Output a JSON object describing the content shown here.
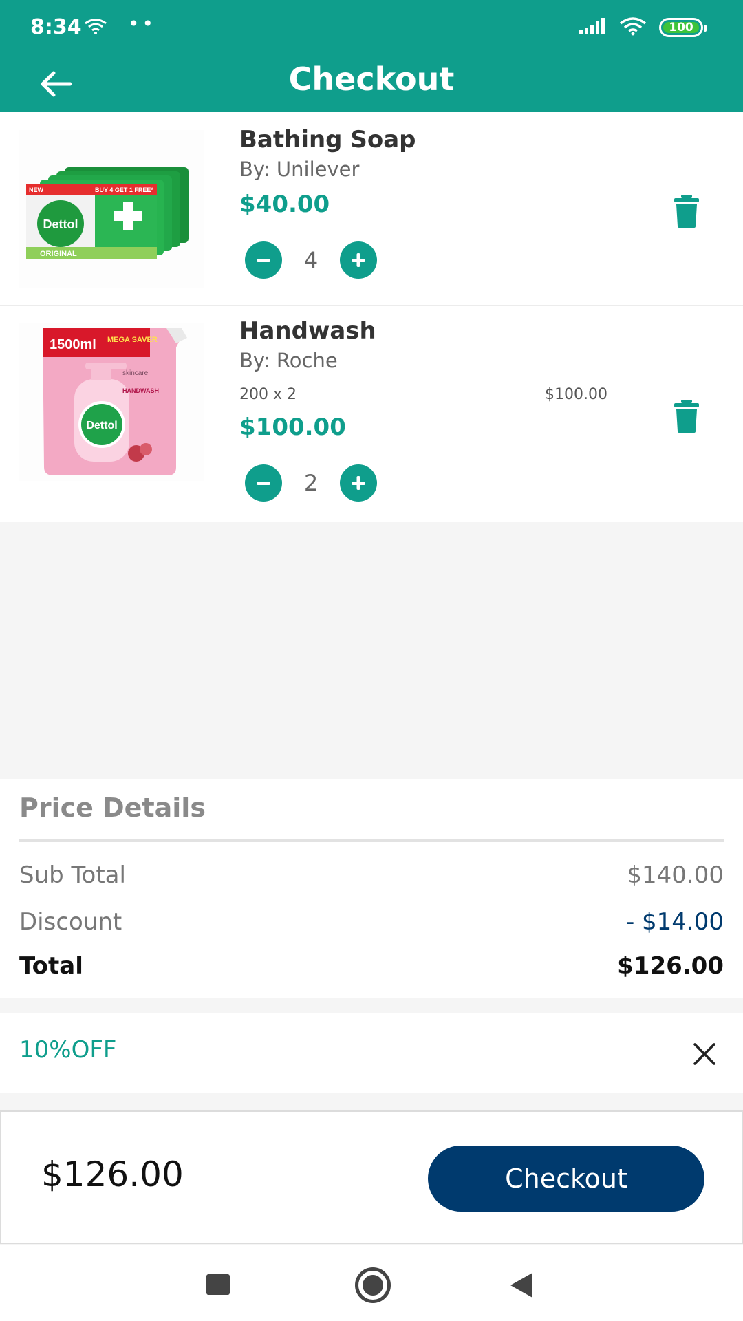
{
  "status_bar": {
    "time": "8:34",
    "dots": "••",
    "battery": "100",
    "wifi_icon": "wifi-icon",
    "signal_icon": "signal-icon"
  },
  "header": {
    "title": "Checkout",
    "back_icon": "arrow-left-icon"
  },
  "cart": {
    "items": [
      {
        "name": "Bathing Soap",
        "brand": "By: Unilever",
        "price": "$40.00",
        "quantity": "4",
        "image_text": [
          "Dettol",
          "BUY 4 GET 1 FREE*",
          "ORIGINAL",
          "NEW"
        ]
      },
      {
        "name": "Handwash",
        "brand": "By: Roche",
        "variant": "200 x 2",
        "variant_price": "$100.00",
        "price": "$100.00",
        "quantity": "2",
        "image_text": [
          "1500ml",
          "MEGA SAVER",
          "Dettol",
          "skincare",
          "HANDWASH"
        ]
      }
    ]
  },
  "price_details": {
    "title": "Price Details",
    "sub_total_label": "Sub Total",
    "sub_total_value": "$140.00",
    "discount_label": "Discount",
    "discount_value": "- $14.00",
    "total_label": "Total",
    "total_value": "$126.00"
  },
  "coupon": {
    "code": "10%OFF"
  },
  "checkout_bar": {
    "total": "$126.00",
    "button_label": "Checkout"
  },
  "colors": {
    "primary": "#0f9e8c",
    "navy": "#003a6e"
  }
}
